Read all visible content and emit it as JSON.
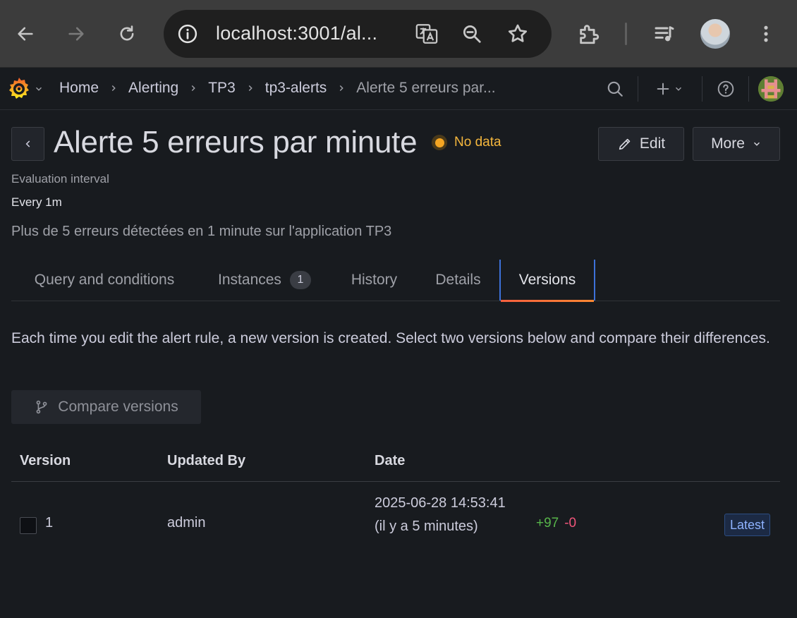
{
  "browser": {
    "url": "localhost:3001/al...",
    "colors": {
      "frame": "#3c3c3c",
      "omnibox": "#1f1f1f"
    }
  },
  "topbar": {
    "breadcrumbs": [
      "Home",
      "Alerting",
      "TP3",
      "tp3-alerts",
      "Alerte 5 erreurs par..."
    ]
  },
  "rule": {
    "title": "Alerte 5 erreurs par minute",
    "state": "No data",
    "edit_label": "Edit",
    "more_label": "More",
    "evaluation_label": "Evaluation interval",
    "evaluation_value": "Every 1m",
    "description": "Plus de 5 erreurs détectées en 1 minute sur l'application TP3"
  },
  "tabs": [
    {
      "label": "Query and conditions"
    },
    {
      "label": "Instances",
      "count": "1"
    },
    {
      "label": "History"
    },
    {
      "label": "Details"
    },
    {
      "label": "Versions",
      "active": true
    }
  ],
  "versions": {
    "info": "Each time you edit the alert rule, a new version is created. Select two versions below and compare their differences.",
    "compare_label": "Compare versions",
    "columns": [
      "Version",
      "Updated By",
      "Date"
    ],
    "rows": [
      {
        "version": "1",
        "updated_by": "admin",
        "date": "2025-06-28 14:53:41 (il y a 5 minutes)",
        "added": "+97",
        "removed": "-0",
        "badge": "Latest"
      }
    ]
  },
  "colors": {
    "background": "#181b1f",
    "state_no_data": "#f5a623",
    "tab_active_underline": "#ff8833",
    "added": "#57b54a",
    "removed": "#f0557a",
    "latest_badge": "#8fb3ff"
  }
}
